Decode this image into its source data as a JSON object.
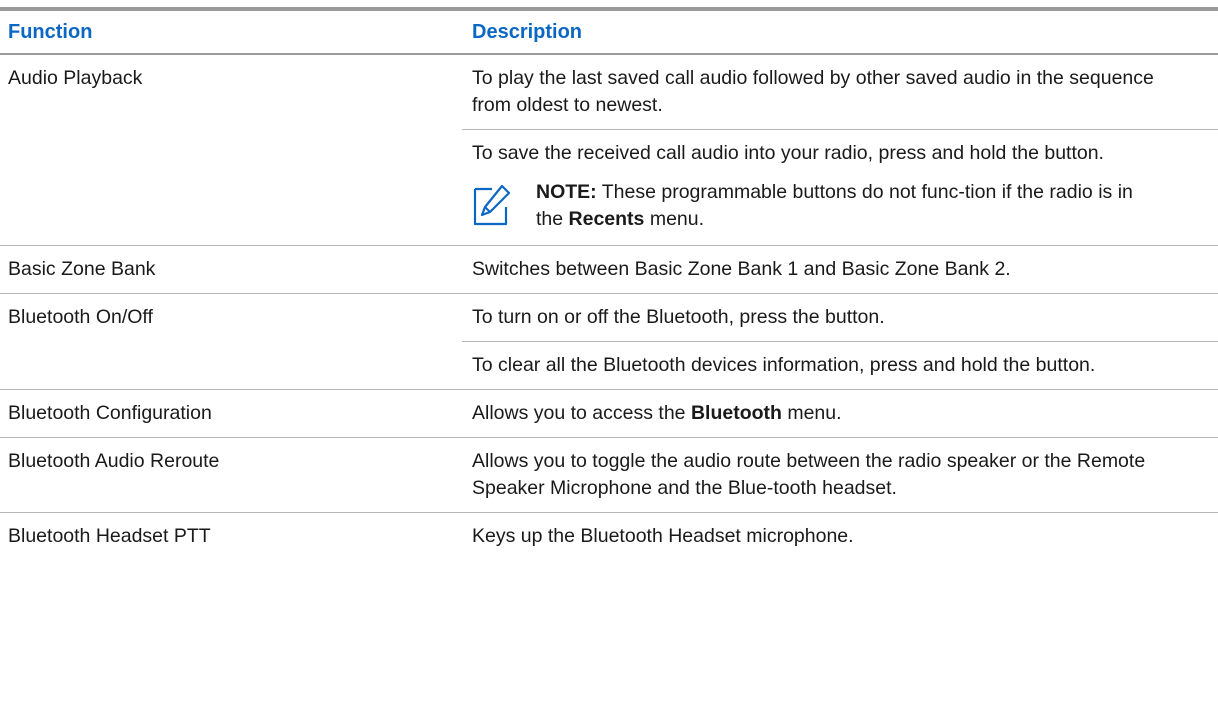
{
  "header": {
    "function": "Function",
    "description": "Description"
  },
  "rows": {
    "audio_playback": {
      "function": "Audio Playback",
      "desc1": "To play the last saved call audio followed by other saved audio in the sequence from oldest to newest.",
      "desc2": "To save the received call audio into your radio, press and hold the button.",
      "note": {
        "label": "NOTE:",
        "text_before": " These programmable buttons do not func-tion if the radio is in the ",
        "emphasis": "Recents",
        "text_after": " menu."
      }
    },
    "basic_zone_bank": {
      "function": "Basic Zone Bank",
      "desc": "Switches between Basic Zone Bank 1 and Basic Zone Bank 2."
    },
    "bluetooth_on_off": {
      "function": "Bluetooth On/Off",
      "desc1": "To turn on or off the Bluetooth, press the button.",
      "desc2": "To clear all the Bluetooth devices information, press and hold the button."
    },
    "bluetooth_configuration": {
      "function": "Bluetooth Configuration",
      "desc_before": "Allows you to access the ",
      "emphasis": "Bluetooth",
      "desc_after": " menu."
    },
    "bluetooth_audio_reroute": {
      "function": "Bluetooth Audio Reroute",
      "desc": "Allows you to toggle the audio route between the radio speaker or the Remote Speaker Microphone and the Blue-tooth headset."
    },
    "bluetooth_headset_ptt": {
      "function": "Bluetooth Headset PTT",
      "desc": "Keys up the Bluetooth Headset microphone."
    }
  },
  "icons": {
    "note": "note-pencil-icon",
    "note_color": "#0a67c4"
  },
  "colors": {
    "header_text": "#0a67c4",
    "rule": "#9b9b9b"
  }
}
